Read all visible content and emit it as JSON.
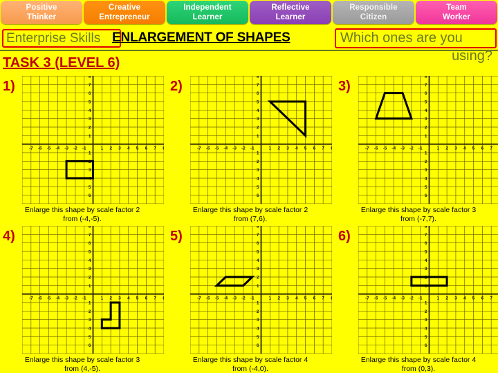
{
  "banner": {
    "skills": [
      {
        "line1": "Positive",
        "line2": "Thinker",
        "color": "#f79a4d"
      },
      {
        "line1": "Creative",
        "line2": "Entrepreneur",
        "color": "#f57d00"
      },
      {
        "line1": "Independent",
        "line2": "Learner",
        "color": "#16b95c"
      },
      {
        "line1": "Reflective",
        "line2": "Learner",
        "color": "#8b3fb5"
      },
      {
        "line1": "Responsible",
        "line2": "Citizen",
        "color": "#9a9a9a"
      },
      {
        "line1": "Team",
        "line2": "Worker",
        "color": "#f0359a"
      }
    ]
  },
  "header": {
    "enterprise_label": "Enterprise Skills",
    "title": "ENLARGEMENT OF SHAPES",
    "question_line1": "Which ones are you",
    "question_line2": "using?",
    "task_label": "TASK 3 (LEVEL 6)",
    "accent_red": "#e00000",
    "accent_olive": "#6b7a1f",
    "background": "#FFFF00"
  },
  "chart_data": [
    {
      "type": "scatter",
      "id": "q1",
      "number": "1)",
      "title": "",
      "xlabel": "",
      "ylabel": "",
      "xlim": [
        -8,
        8
      ],
      "ylim": [
        -7,
        8
      ],
      "xticks": [
        -7,
        -6,
        -5,
        -4,
        -3,
        -2,
        -1,
        1,
        2,
        3,
        4,
        5,
        6,
        7,
        8
      ],
      "yticks": [
        8,
        7,
        6,
        5,
        4,
        3,
        2,
        1,
        -1,
        -2,
        -3,
        -4,
        -5,
        -6
      ],
      "grid": true,
      "shape_name": "rectangle",
      "shape_points": [
        [
          -3,
          -2
        ],
        [
          0,
          -2
        ],
        [
          0,
          -4
        ],
        [
          -3,
          -4
        ]
      ],
      "caption_line1": "Enlarge this shape by scale factor 2",
      "caption_line2": "from (-4,-5).",
      "scale_factor": 2,
      "centre": [
        -4,
        -5
      ]
    },
    {
      "type": "scatter",
      "id": "q2",
      "number": "2)",
      "title": "",
      "xlabel": "",
      "ylabel": "",
      "xlim": [
        -8,
        8
      ],
      "ylim": [
        -7,
        8
      ],
      "xticks": [
        -7,
        -6,
        -5,
        -4,
        -3,
        -2,
        -1,
        1,
        2,
        3,
        4,
        5,
        6,
        7,
        8
      ],
      "yticks": [
        8,
        7,
        6,
        5,
        4,
        3,
        2,
        1,
        -1,
        -2,
        -3,
        -4,
        -5,
        -6
      ],
      "grid": true,
      "shape_name": "right-triangle",
      "shape_points": [
        [
          1,
          5
        ],
        [
          5,
          5
        ],
        [
          5,
          1
        ]
      ],
      "caption_line1": "Enlarge this shape by scale factor 2",
      "caption_line2": "from (7,6).",
      "scale_factor": 2,
      "centre": [
        7,
        6
      ]
    },
    {
      "type": "scatter",
      "id": "q3",
      "number": "3)",
      "title": "",
      "xlabel": "",
      "ylabel": "",
      "xlim": [
        -8,
        8
      ],
      "ylim": [
        -7,
        8
      ],
      "xticks": [
        -7,
        -6,
        -5,
        -4,
        -3,
        -2,
        -1,
        1,
        2,
        3,
        4,
        5,
        6,
        7,
        8
      ],
      "yticks": [
        8,
        7,
        6,
        5,
        4,
        3,
        2,
        1,
        -1,
        -2,
        -3,
        -4,
        -5,
        -6
      ],
      "grid": true,
      "shape_name": "trapezium",
      "shape_points": [
        [
          -5,
          6
        ],
        [
          -3,
          6
        ],
        [
          -2,
          3
        ],
        [
          -6,
          3
        ]
      ],
      "caption_line1": "Enlarge this shape by scale factor 3",
      "caption_line2": "from (-7,7).",
      "scale_factor": 3,
      "centre": [
        -7,
        7
      ]
    },
    {
      "type": "scatter",
      "id": "q4",
      "number": "4)",
      "title": "",
      "xlabel": "",
      "ylabel": "",
      "xlim": [
        -8,
        8
      ],
      "ylim": [
        -7,
        8
      ],
      "xticks": [
        -7,
        -6,
        -5,
        -4,
        -3,
        -2,
        -1,
        1,
        2,
        3,
        4,
        5,
        6,
        7,
        8
      ],
      "yticks": [
        8,
        7,
        6,
        5,
        4,
        3,
        2,
        1,
        -1,
        -2,
        -3,
        -4,
        -5,
        -6
      ],
      "grid": true,
      "shape_name": "L-shape",
      "shape_points": [
        [
          2,
          -1
        ],
        [
          3,
          -1
        ],
        [
          3,
          -4
        ],
        [
          1,
          -4
        ],
        [
          1,
          -3
        ],
        [
          2,
          -3
        ]
      ],
      "caption_line1": "Enlarge this shape by scale factor 3",
      "caption_line2": "from (4,-5).",
      "scale_factor": 3,
      "centre": [
        4,
        -5
      ]
    },
    {
      "type": "scatter",
      "id": "q5",
      "number": "5)",
      "title": "",
      "xlabel": "",
      "ylabel": "",
      "xlim": [
        -8,
        8
      ],
      "ylim": [
        -7,
        8
      ],
      "xticks": [
        -7,
        -6,
        -5,
        -4,
        -3,
        -2,
        -1,
        1,
        2,
        3,
        4,
        5,
        6,
        7,
        8
      ],
      "yticks": [
        8,
        7,
        6,
        5,
        4,
        3,
        2,
        1,
        -1,
        -2,
        -3,
        -4,
        -5,
        -6
      ],
      "grid": true,
      "shape_name": "parallelogram",
      "shape_points": [
        [
          -4,
          2
        ],
        [
          -1,
          2
        ],
        [
          -2,
          1
        ],
        [
          -5,
          1
        ]
      ],
      "caption_line1": "Enlarge this shape by scale factor 4",
      "caption_line2": "from (-4,0).",
      "scale_factor": 4,
      "centre": [
        -4,
        0
      ]
    },
    {
      "type": "scatter",
      "id": "q6",
      "number": "6)",
      "title": "",
      "xlabel": "",
      "ylabel": "",
      "xlim": [
        -8,
        8
      ],
      "ylim": [
        -7,
        8
      ],
      "xticks": [
        -7,
        -6,
        -5,
        -4,
        -3,
        -2,
        -1,
        1,
        2,
        3,
        4,
        5,
        6,
        7,
        8
      ],
      "yticks": [
        8,
        7,
        6,
        5,
        4,
        3,
        2,
        1,
        -1,
        -2,
        -3,
        -4,
        -5,
        -6
      ],
      "grid": true,
      "shape_name": "rectangle",
      "shape_points": [
        [
          -2,
          2
        ],
        [
          2,
          2
        ],
        [
          2,
          1
        ],
        [
          -2,
          1
        ]
      ],
      "caption_line1": "Enlarge this shape by scale factor 4",
      "caption_line2": "from (0,3).",
      "scale_factor": 4,
      "centre": [
        0,
        3
      ]
    }
  ]
}
